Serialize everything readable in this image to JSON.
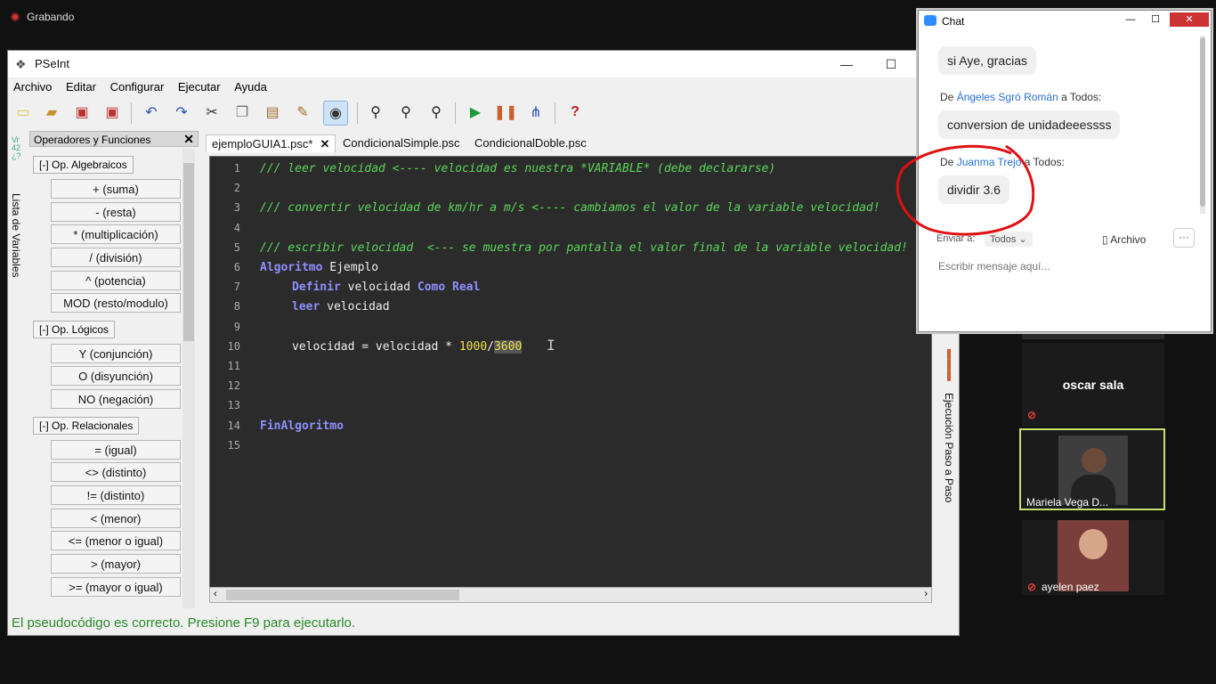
{
  "recording": {
    "label": "Grabando"
  },
  "pseint": {
    "title": "PSeInt",
    "menu": [
      "Archivo",
      "Editar",
      "Configurar",
      "Ejecutar",
      "Ayuda"
    ],
    "toolbar_icons": [
      "new-file-icon",
      "open-file-icon",
      "save-icon",
      "save-as-icon",
      "undo-icon",
      "redo-icon",
      "cut-icon",
      "copy-icon",
      "paste-icon",
      "edit-icon",
      "debug-view-icon",
      "find-icon",
      "find-prev-icon",
      "find-next-icon",
      "run-icon",
      "step-icon",
      "flowchart-icon",
      "help-icon"
    ],
    "left_strip_label": "Lista de Variables",
    "ops_panel": {
      "title": "Operadores y Funciones",
      "groups": [
        {
          "label": "[-]  Op. Algebraicos",
          "items": [
            "+ (suma)",
            "- (resta)",
            "* (multiplicación)",
            "/ (división)",
            "^ (potencia)",
            "MOD (resto/modulo)"
          ]
        },
        {
          "label": "[-]  Op. Lógicos",
          "items": [
            "Y (conjunción)",
            "O (disyunción)",
            "NO (negación)"
          ]
        },
        {
          "label": "[-]  Op. Relacionales",
          "items": [
            "= (igual)",
            "<> (distinto)",
            "!= (distinto)",
            "< (menor)",
            "<= (menor o igual)",
            "> (mayor)",
            ">= (mayor o igual)"
          ]
        }
      ]
    },
    "tabs": [
      "ejemploGUIA1.psc*",
      "CondicionalSimple.psc",
      "CondicionalDoble.psc"
    ],
    "code_lines": [
      {
        "n": "1",
        "comment": "/// leer velocidad <---- velocidad es nuestra *VARIABLE* (debe declararse)"
      },
      {
        "n": "2"
      },
      {
        "n": "3",
        "comment": "/// convertir velocidad de km/hr a m/s <---- cambiamos el valor de la variable velocidad!"
      },
      {
        "n": "4"
      },
      {
        "n": "5",
        "comment": "/// escribir velocidad  <--- se muestra por pantalla el valor final de la variable velocidad!"
      },
      {
        "n": "6",
        "kw": "Algoritmo",
        "rest": " Ejemplo"
      },
      {
        "n": "7",
        "kw": "Definir",
        "id": " velocidad ",
        "kw2": "Como Real"
      },
      {
        "n": "8",
        "kw": "leer",
        "id": " velocidad"
      },
      {
        "n": "9"
      },
      {
        "n": "10",
        "id": "velocidad = velocidad * ",
        "num": "1000",
        "op": "/",
        "sel": "3600"
      },
      {
        "n": "11"
      },
      {
        "n": "12"
      },
      {
        "n": "13"
      },
      {
        "n": "14",
        "kw": "FinAlgoritmo"
      },
      {
        "n": "15"
      }
    ],
    "status": "El pseudocódigo es correcto. Presione F9 para ejecutarlo.",
    "right_strip_label": "Ejecución Paso a Paso"
  },
  "gallery": {
    "tiles": [
      {
        "name": "oscar sala",
        "muted": true
      },
      {
        "name": "Mariela Vega D...",
        "active": true
      },
      {
        "name": "ayelen paez",
        "muted": true
      }
    ]
  },
  "chat": {
    "title": "Chat",
    "messages": [
      {
        "text": "si Aye, gracias"
      },
      {
        "from_prefix": "De ",
        "from": "Ángeles Sgró Román",
        "to_suffix": " a Todos:",
        "text": "conversion de unidadeeessss"
      },
      {
        "from_prefix": "De ",
        "from": "Juanma Trejo",
        "to_suffix": " a Todos:",
        "text": "dividir 3.6"
      }
    ],
    "send_to_label": "Enviar a:",
    "send_to_value": "Todos",
    "file_label": "Archivo",
    "more_label": "···",
    "input_placeholder": "Escribir mensaje aquí..."
  },
  "colors": {
    "chat_accent": "#2d8cff",
    "annotation": "#e01010",
    "status_ok": "#2a8a2a",
    "active_tile_border": "#c8e06a"
  }
}
